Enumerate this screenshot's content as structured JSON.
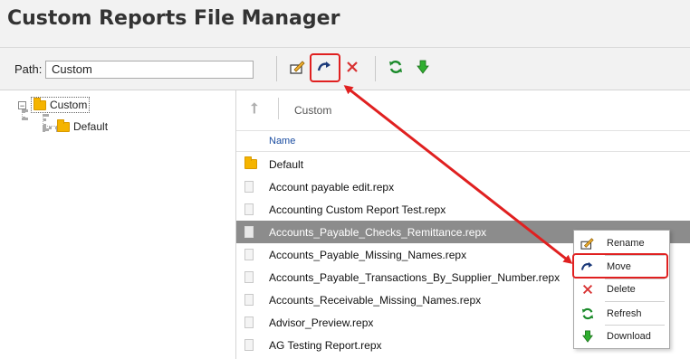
{
  "title": "Custom Reports File Manager",
  "path": {
    "label": "Path:",
    "value": "Custom"
  },
  "toolbar": {
    "buttons": [
      {
        "name": "rename",
        "icon": "rename-icon"
      },
      {
        "name": "move",
        "icon": "move-icon",
        "highlighted": true
      },
      {
        "name": "delete",
        "icon": "delete-icon"
      },
      {
        "name": "refresh",
        "icon": "refresh-icon"
      },
      {
        "name": "download",
        "icon": "download-icon"
      }
    ]
  },
  "tree": {
    "root": {
      "label": "Custom",
      "expanded": true,
      "selected": true
    },
    "children": [
      {
        "label": "Default"
      }
    ]
  },
  "files": {
    "breadcrumb": "Custom",
    "column_name": "Name",
    "items": [
      {
        "name": "Default",
        "type": "folder"
      },
      {
        "name": "Account payable edit.repx",
        "type": "file"
      },
      {
        "name": "Accounting Custom Report Test.repx",
        "type": "file"
      },
      {
        "name": "Accounts_Payable_Checks_Remittance.repx",
        "type": "file",
        "selected": true
      },
      {
        "name": "Accounts_Payable_Missing_Names.repx",
        "type": "file"
      },
      {
        "name": "Accounts_Payable_Transactions_By_Supplier_Number.repx",
        "type": "file"
      },
      {
        "name": "Accounts_Receivable_Missing_Names.repx",
        "type": "file"
      },
      {
        "name": "Advisor_Preview.repx",
        "type": "file"
      },
      {
        "name": "AG Testing Report.repx",
        "type": "file"
      }
    ]
  },
  "context_menu": {
    "items": [
      {
        "label": "Rename",
        "icon": "rename-icon"
      },
      {
        "label": "Move",
        "icon": "move-icon",
        "highlighted": true
      },
      {
        "label": "Delete",
        "icon": "delete-icon"
      },
      {
        "label": "Refresh",
        "icon": "refresh-icon"
      },
      {
        "label": "Download",
        "icon": "download-icon"
      }
    ]
  },
  "colors": {
    "highlight": "#e02020",
    "selected_row": "#8c8c8c",
    "link_blue": "#1a4ca0",
    "folder": "#f5b400"
  }
}
